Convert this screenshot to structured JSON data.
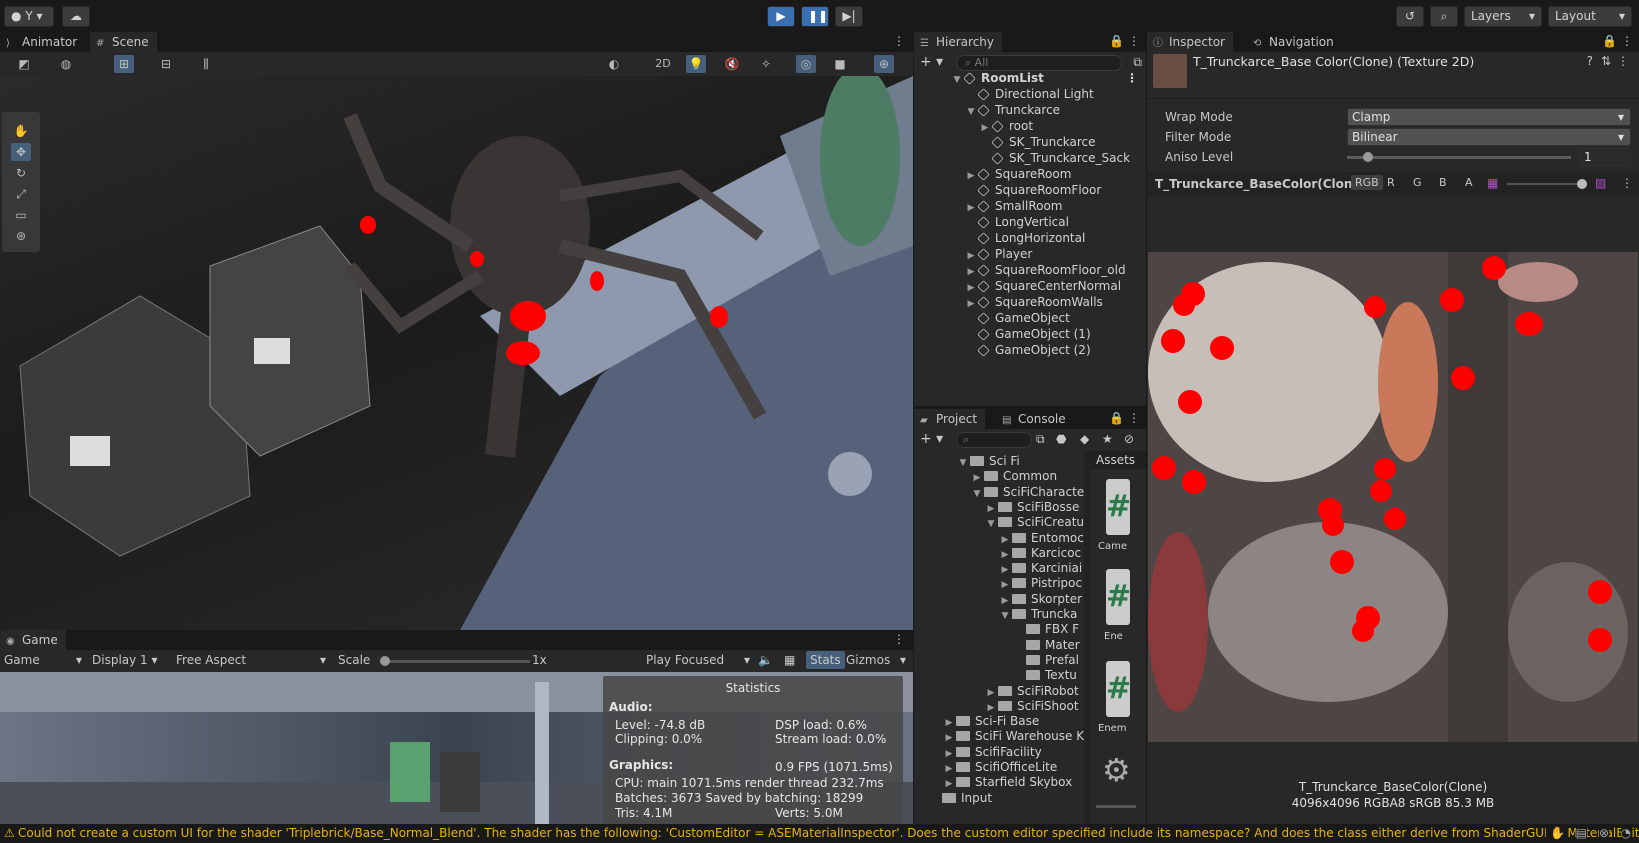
{
  "toolbar": {
    "account": "Y",
    "layers": "Layers",
    "layout": "Layout"
  },
  "scene_tabs": [
    "Animator",
    "Scene"
  ],
  "scene_toolbar": {
    "mode2d": "2D"
  },
  "game": {
    "tab": "Game",
    "view": "Game",
    "display": "Display 1",
    "aspect": "Free Aspect",
    "scale_label": "Scale",
    "scale_value": "1x",
    "play_mode": "Play Focused",
    "stats": "Stats",
    "gizmos": "Gizmos"
  },
  "stats": {
    "title": "Statistics",
    "audio": "Audio:",
    "level": "Level: -74.8 dB",
    "clipping": "Clipping: 0.0%",
    "dsp": "DSP load: 0.6%",
    "stream": "Stream load: 0.0%",
    "graphics": "Graphics:",
    "fps": "0.9 FPS (1071.5ms)",
    "cpu": "CPU: main 1071.5ms  render thread 232.7ms",
    "batches": "Batches: 3673   Saved by batching: 18299",
    "tris": "Tris: 4.1M",
    "verts": "Verts: 5.0M"
  },
  "hierarchy": {
    "tab": "Hierarchy",
    "search": "All",
    "root": "RoomList",
    "items": [
      {
        "label": "Directional Light",
        "depth": 1,
        "arrow": ""
      },
      {
        "label": "Trunckarce",
        "depth": 1,
        "arrow": "down"
      },
      {
        "label": "root",
        "depth": 2,
        "arrow": "right"
      },
      {
        "label": "SK_Trunckarce",
        "depth": 2,
        "arrow": ""
      },
      {
        "label": "SK_Trunckarce_Sack",
        "depth": 2,
        "arrow": ""
      },
      {
        "label": "SquareRoom",
        "depth": 1,
        "arrow": "right"
      },
      {
        "label": "SquareRoomFloor",
        "depth": 1,
        "arrow": ""
      },
      {
        "label": "SmallRoom",
        "depth": 1,
        "arrow": "right"
      },
      {
        "label": "LongVertical",
        "depth": 1,
        "arrow": ""
      },
      {
        "label": "LongHorizontal",
        "depth": 1,
        "arrow": ""
      },
      {
        "label": "Player",
        "depth": 1,
        "arrow": "right"
      },
      {
        "label": "SquareRoomFloor_old",
        "depth": 1,
        "arrow": "right"
      },
      {
        "label": "SquareCenterNormal",
        "depth": 1,
        "arrow": "right"
      },
      {
        "label": "SquareRoomWalls",
        "depth": 1,
        "arrow": "right"
      },
      {
        "label": "GameObject",
        "depth": 1,
        "arrow": ""
      },
      {
        "label": "GameObject (1)",
        "depth": 1,
        "arrow": ""
      },
      {
        "label": "GameObject (2)",
        "depth": 1,
        "arrow": ""
      }
    ]
  },
  "project": {
    "tabs": [
      "Project",
      "Console"
    ],
    "assets_label": "Assets",
    "tree": [
      {
        "label": "Sci Fi",
        "depth": 0,
        "arrow": "down"
      },
      {
        "label": "Common",
        "depth": 1,
        "arrow": "right"
      },
      {
        "label": "SciFiCharacte",
        "depth": 1,
        "arrow": "down"
      },
      {
        "label": "SciFiBosse",
        "depth": 2,
        "arrow": "right"
      },
      {
        "label": "SciFiCreatu",
        "depth": 2,
        "arrow": "down"
      },
      {
        "label": "Entomoc",
        "depth": 3,
        "arrow": "right"
      },
      {
        "label": "Karcicoc",
        "depth": 3,
        "arrow": "right"
      },
      {
        "label": "Karciniai",
        "depth": 3,
        "arrow": "right"
      },
      {
        "label": "Pistripoc",
        "depth": 3,
        "arrow": "right"
      },
      {
        "label": "Skorpter",
        "depth": 3,
        "arrow": "right"
      },
      {
        "label": "Truncka",
        "depth": 3,
        "arrow": "down"
      },
      {
        "label": "FBX F",
        "depth": 4,
        "arrow": ""
      },
      {
        "label": "Mater",
        "depth": 4,
        "arrow": ""
      },
      {
        "label": "Prefal",
        "depth": 4,
        "arrow": ""
      },
      {
        "label": "Textu",
        "depth": 4,
        "arrow": ""
      },
      {
        "label": "SciFiRobot",
        "depth": 2,
        "arrow": "right"
      },
      {
        "label": "SciFiShoot",
        "depth": 2,
        "arrow": "right"
      },
      {
        "label": "Sci-Fi Base",
        "depth": -1,
        "arrow": "right"
      },
      {
        "label": "SciFi Warehouse K",
        "depth": -1,
        "arrow": "right"
      },
      {
        "label": "ScifiFacility",
        "depth": -1,
        "arrow": "right"
      },
      {
        "label": "ScifiOfficeLite",
        "depth": -1,
        "arrow": "right"
      },
      {
        "label": "Starfield Skybox",
        "depth": -1,
        "arrow": "right"
      },
      {
        "label": "Input",
        "depth": -2,
        "arrow": ""
      }
    ],
    "grid": [
      "Came",
      "Ene",
      "Enem"
    ]
  },
  "inspector": {
    "tabs": [
      "Inspector",
      "Navigation"
    ],
    "asset_title": "T_Trunckarce_Base Color(Clone) (Texture 2D)",
    "wrap_label": "Wrap Mode",
    "wrap_value": "Clamp",
    "filter_label": "Filter Mode",
    "filter_value": "Bilinear",
    "aniso_label": "Aniso Level",
    "aniso_value": "1",
    "preview_name": "T_Trunckarce_BaseColor(Clone)",
    "channels": [
      "RGB",
      "R",
      "G",
      "B",
      "A"
    ],
    "preview_caption": "T_Trunckarce_BaseColor(Clone)",
    "preview_info": "4096x4096  RGBA8 sRGB   85.3 MB"
  },
  "status": {
    "message": "Could not create a custom UI for the shader 'Triplebrick/Base_Normal_Blend'. The shader has the following: 'CustomEditor = ASEMaterialInspector'. Does the custom editor specified include its namespace? And does the class either derive from ShaderGUI or MaterialEdit"
  }
}
